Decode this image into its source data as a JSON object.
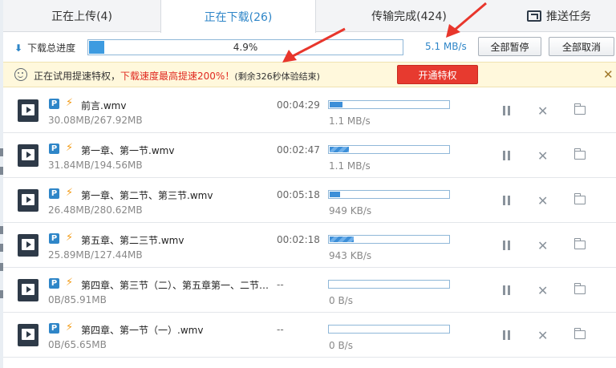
{
  "tabs": [
    {
      "label": "正在上传(4)"
    },
    {
      "label": "正在下载(26)"
    },
    {
      "label": "传输完成(424)"
    },
    {
      "label": "推送任务"
    }
  ],
  "summary": {
    "label": "下载总进度",
    "percent_text": "4.9%",
    "progress": 0.049,
    "speed": "5.1 MB/s",
    "pause_all": "全部暂停",
    "cancel_all": "全部取消"
  },
  "banner": {
    "text1": "正在试用提速特权，",
    "text_highlight": "下载速度最高提速200%！",
    "text2": "(剩余326秒体验结束)",
    "button": "开通特权"
  },
  "downloads": [
    {
      "name": "前言.wmv",
      "size": "30.08MB/267.92MB",
      "time": "00:04:29",
      "speed": "1.1 MB/s",
      "progress": 0.11,
      "striped": false
    },
    {
      "name": "第一章、第一节.wmv",
      "size": "31.84MB/194.56MB",
      "time": "00:02:47",
      "speed": "1.1 MB/s",
      "progress": 0.16,
      "striped": true
    },
    {
      "name": "第一章、第二节、第三节.wmv",
      "size": "26.48MB/280.62MB",
      "time": "00:05:18",
      "speed": "949 KB/s",
      "progress": 0.09,
      "striped": false
    },
    {
      "name": "第五章、第二三节.wmv",
      "size": "25.89MB/127.44MB",
      "time": "00:02:18",
      "speed": "943 KB/s",
      "progress": 0.2,
      "striped": true
    },
    {
      "name": "第四章、第三节（二）、第五章第一、二节…",
      "size": "0B/85.91MB",
      "time": "--",
      "speed": "0 B/s",
      "progress": 0,
      "striped": false
    },
    {
      "name": "第四章、第一节（一）.wmv",
      "size": "0B/65.65MB",
      "time": "--",
      "speed": "0 B/s",
      "progress": 0,
      "striped": false
    }
  ]
}
